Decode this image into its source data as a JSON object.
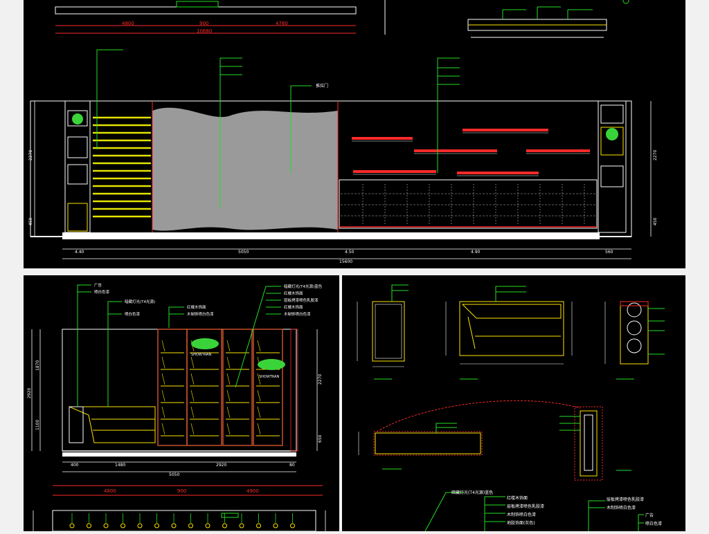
{
  "colors": {
    "background": "#000000",
    "page": "#f1f1f1",
    "frame": "#ffffff",
    "dimension": "#ff2a2a",
    "leader": "#22e022",
    "shelf": "#e4e400",
    "furniture": "#ffe600",
    "panel": "#9a9a9a",
    "plant": "#3ad43a",
    "text": "#ffffff",
    "marker": "#ff2a2a"
  },
  "top_plan": {
    "dims": [
      "4800",
      "900",
      "4780"
    ],
    "total": "10680"
  },
  "elevation_a": {
    "dims": [
      "4.40",
      "5050",
      "4.50",
      "4.90",
      "560"
    ],
    "total": "15600",
    "heights_left": [
      "2270",
      "450"
    ],
    "heights_right": [
      "2270",
      "450"
    ],
    "door_label": "推拉门"
  },
  "elevation_b": {
    "labels_left": [
      "广告",
      "喷白色漆",
      "暗藏灯光(T4光源)",
      "喷白色漆"
    ],
    "labels_right": [
      "暗藏灯光(T4光源)蓝色",
      "红楼木饰面",
      "层板烤漆喷色乳胶漆",
      "红楼木饰面",
      "木制饰喷白色漆"
    ],
    "brand_a": "SHOWTRAN",
    "brand_b": "SHOWTRAN",
    "dims": [
      "400",
      "1480",
      "2920",
      "80"
    ],
    "total": "5050",
    "heights_left": [
      "2920",
      "1870",
      "1100"
    ],
    "heights_right": [
      "2270",
      "650"
    ]
  },
  "elevation_c": {
    "dims": [
      "4800",
      "900",
      "4900"
    ],
    "labels_right": [
      "广告",
      "喷白色漆"
    ]
  },
  "details": {
    "bottom_leaders_a": [
      "暗藏灯光(T4光源)蓝色",
      "红楼木饰面",
      "层板烤漆喷色乳胶漆",
      "木制饰喷白色漆",
      "地胶饰面(灰色)"
    ],
    "bottom_leaders_b": [
      "层板烤漆喷色乳胶漆",
      "木制饰喷白色漆"
    ]
  }
}
